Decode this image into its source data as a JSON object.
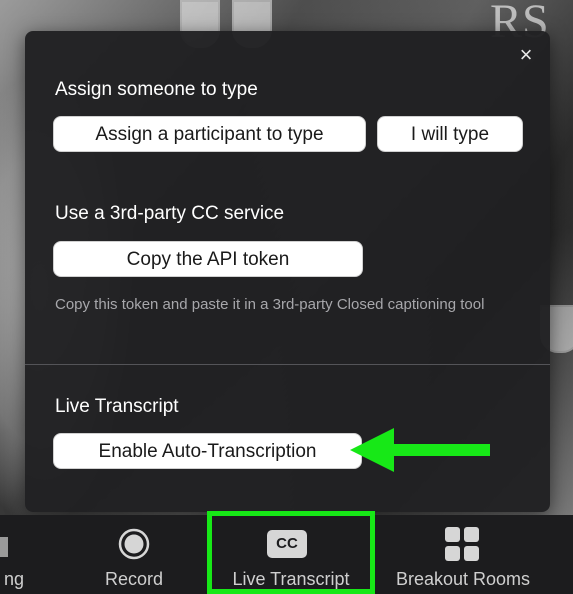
{
  "popup": {
    "close_glyph": "×",
    "assign_section": {
      "heading": "Assign someone to type",
      "assign_button": "Assign a participant to type",
      "self_button": "I will type"
    },
    "third_party_section": {
      "heading": "Use a 3rd-party CC service",
      "copy_button": "Copy the API token",
      "helper_text": "Copy this token and paste it in a 3rd-party Closed captioning tool"
    },
    "live_section": {
      "heading": "Live Transcript",
      "enable_button": "Enable Auto-Transcription"
    }
  },
  "toolbar": {
    "partial_label": "ng",
    "items": [
      {
        "label": "Record",
        "icon": "record-icon"
      },
      {
        "label": "Live Transcript",
        "icon": "cc-icon",
        "badge": "CC"
      },
      {
        "label": "Breakout Rooms",
        "icon": "breakout-rooms-icon"
      }
    ]
  },
  "background": {
    "letters_top": "RS",
    "letters_right": "R"
  },
  "colors": {
    "annotation_green": "#17e817",
    "panel_bg": "#202022",
    "toolbar_bg": "#1c1c1e"
  }
}
